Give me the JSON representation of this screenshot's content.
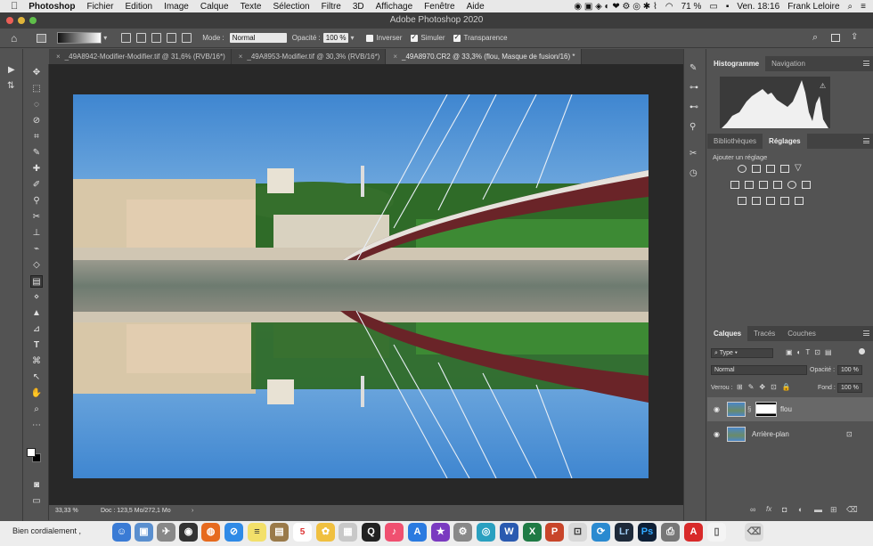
{
  "menubar": {
    "apple": "",
    "items": [
      "Photoshop",
      "Fichier",
      "Edition",
      "Image",
      "Calque",
      "Texte",
      "Sélection",
      "Filtre",
      "3D",
      "Affichage",
      "Fenêtre",
      "Aide"
    ],
    "battery": "71 %",
    "clock": "Ven. 18:16",
    "user": "Frank Leloire"
  },
  "window": {
    "title": "Adobe Photoshop 2020"
  },
  "options": {
    "mode_label": "Mode :",
    "mode_value": "Normal",
    "opacity_label": "Opacité :",
    "opacity_value": "100 %",
    "invert_label": "Inverser",
    "simulate_label": "Simuler",
    "transparency_label": "Transparence"
  },
  "tabs": [
    {
      "label": "_49A8942-Modifier-Modifier.tif @ 31,6% (RVB/16*)"
    },
    {
      "label": "_49A8953-Modifier.tif @ 30,3% (RVB/16*)"
    },
    {
      "label": "_49A8970.CR2 @ 33,3% (flou, Masque de fusion/16) *"
    }
  ],
  "status": {
    "zoom": "33,33 %",
    "doc": "Doc : 123,5 Mo/272,1 Mo"
  },
  "panels": {
    "top_tabs": [
      "Histogramme",
      "Navigation"
    ],
    "mid_tabs": [
      "Bibliothèques",
      "Réglages"
    ],
    "add_adjustment": "Ajouter un réglage",
    "layer_tabs": [
      "Calques",
      "Tracés",
      "Couches"
    ],
    "filter_type": "Type",
    "blend_mode": "Normal",
    "opacity_label": "Opacité :",
    "opacity_value": "100 %",
    "lock_label": "Verrou :",
    "fill_label": "Fond :",
    "fill_value": "100 %",
    "layers": [
      {
        "name": "flou",
        "selected": true
      },
      {
        "name": "Arrière-plan",
        "selected": false
      }
    ]
  },
  "dock": {
    "mail_snippet": "Bien cordialement ,",
    "lr_label": "Lr",
    "ps_label": "Ps",
    "cal_day": "5"
  }
}
